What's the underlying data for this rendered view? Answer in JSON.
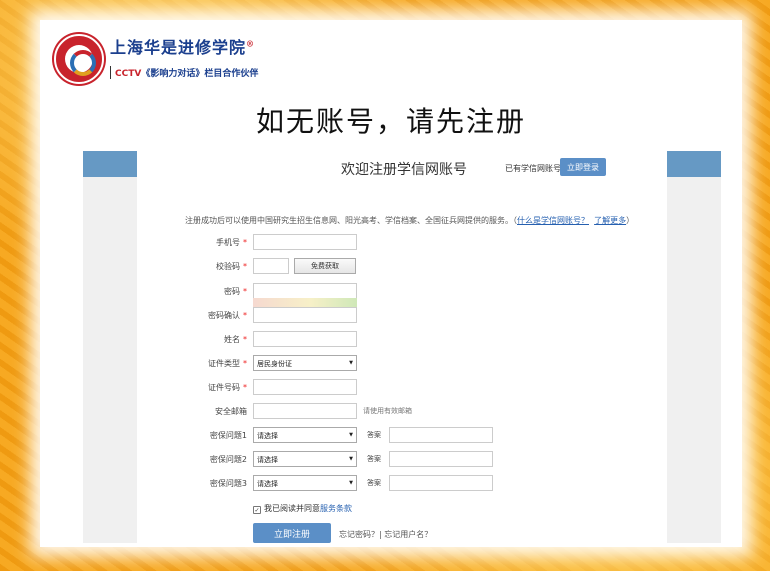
{
  "slide": {
    "brand_name": "上海华是进修学院",
    "brand_mark": "®",
    "cctv_prefix": "CCTV",
    "cctv_text": "《影响力对话》栏目合作伙伴",
    "headline": "如无账号，请先注册"
  },
  "page": {
    "title": "欢迎注册学信网账号",
    "has_account": "已有学信网账号",
    "login_button": "立即登录",
    "intro": "注册成功后可以使用中国研究生招生信息网、阳光高考、学信档案、全国征兵网提供的服务。（",
    "intro_link1": "什么是学信网账号？",
    "intro_link2": "了解更多",
    "intro_end": "）"
  },
  "form": {
    "phone_label": "手机号",
    "code_label": "校验码",
    "code_button": "免费获取",
    "password_label": "密码",
    "confirm_label": "密码确认",
    "name_label": "姓名",
    "id_type_label": "证件类型",
    "id_type_value": "居民身份证",
    "id_number_label": "证件号码",
    "email_label": "安全邮箱",
    "email_hint": "请使用有效邮箱",
    "q1_label": "密保问题1",
    "q2_label": "密保问题2",
    "q3_label": "密保问题3",
    "q_placeholder": "请选择",
    "answer_label": "答案",
    "required_mark": "*",
    "agree_text": "我已阅读并同意",
    "agree_link": "服务条款",
    "check_mark": "✓",
    "submit_button": "立即注册",
    "forgot_text": "忘记密码？| 忘记用户名？"
  }
}
